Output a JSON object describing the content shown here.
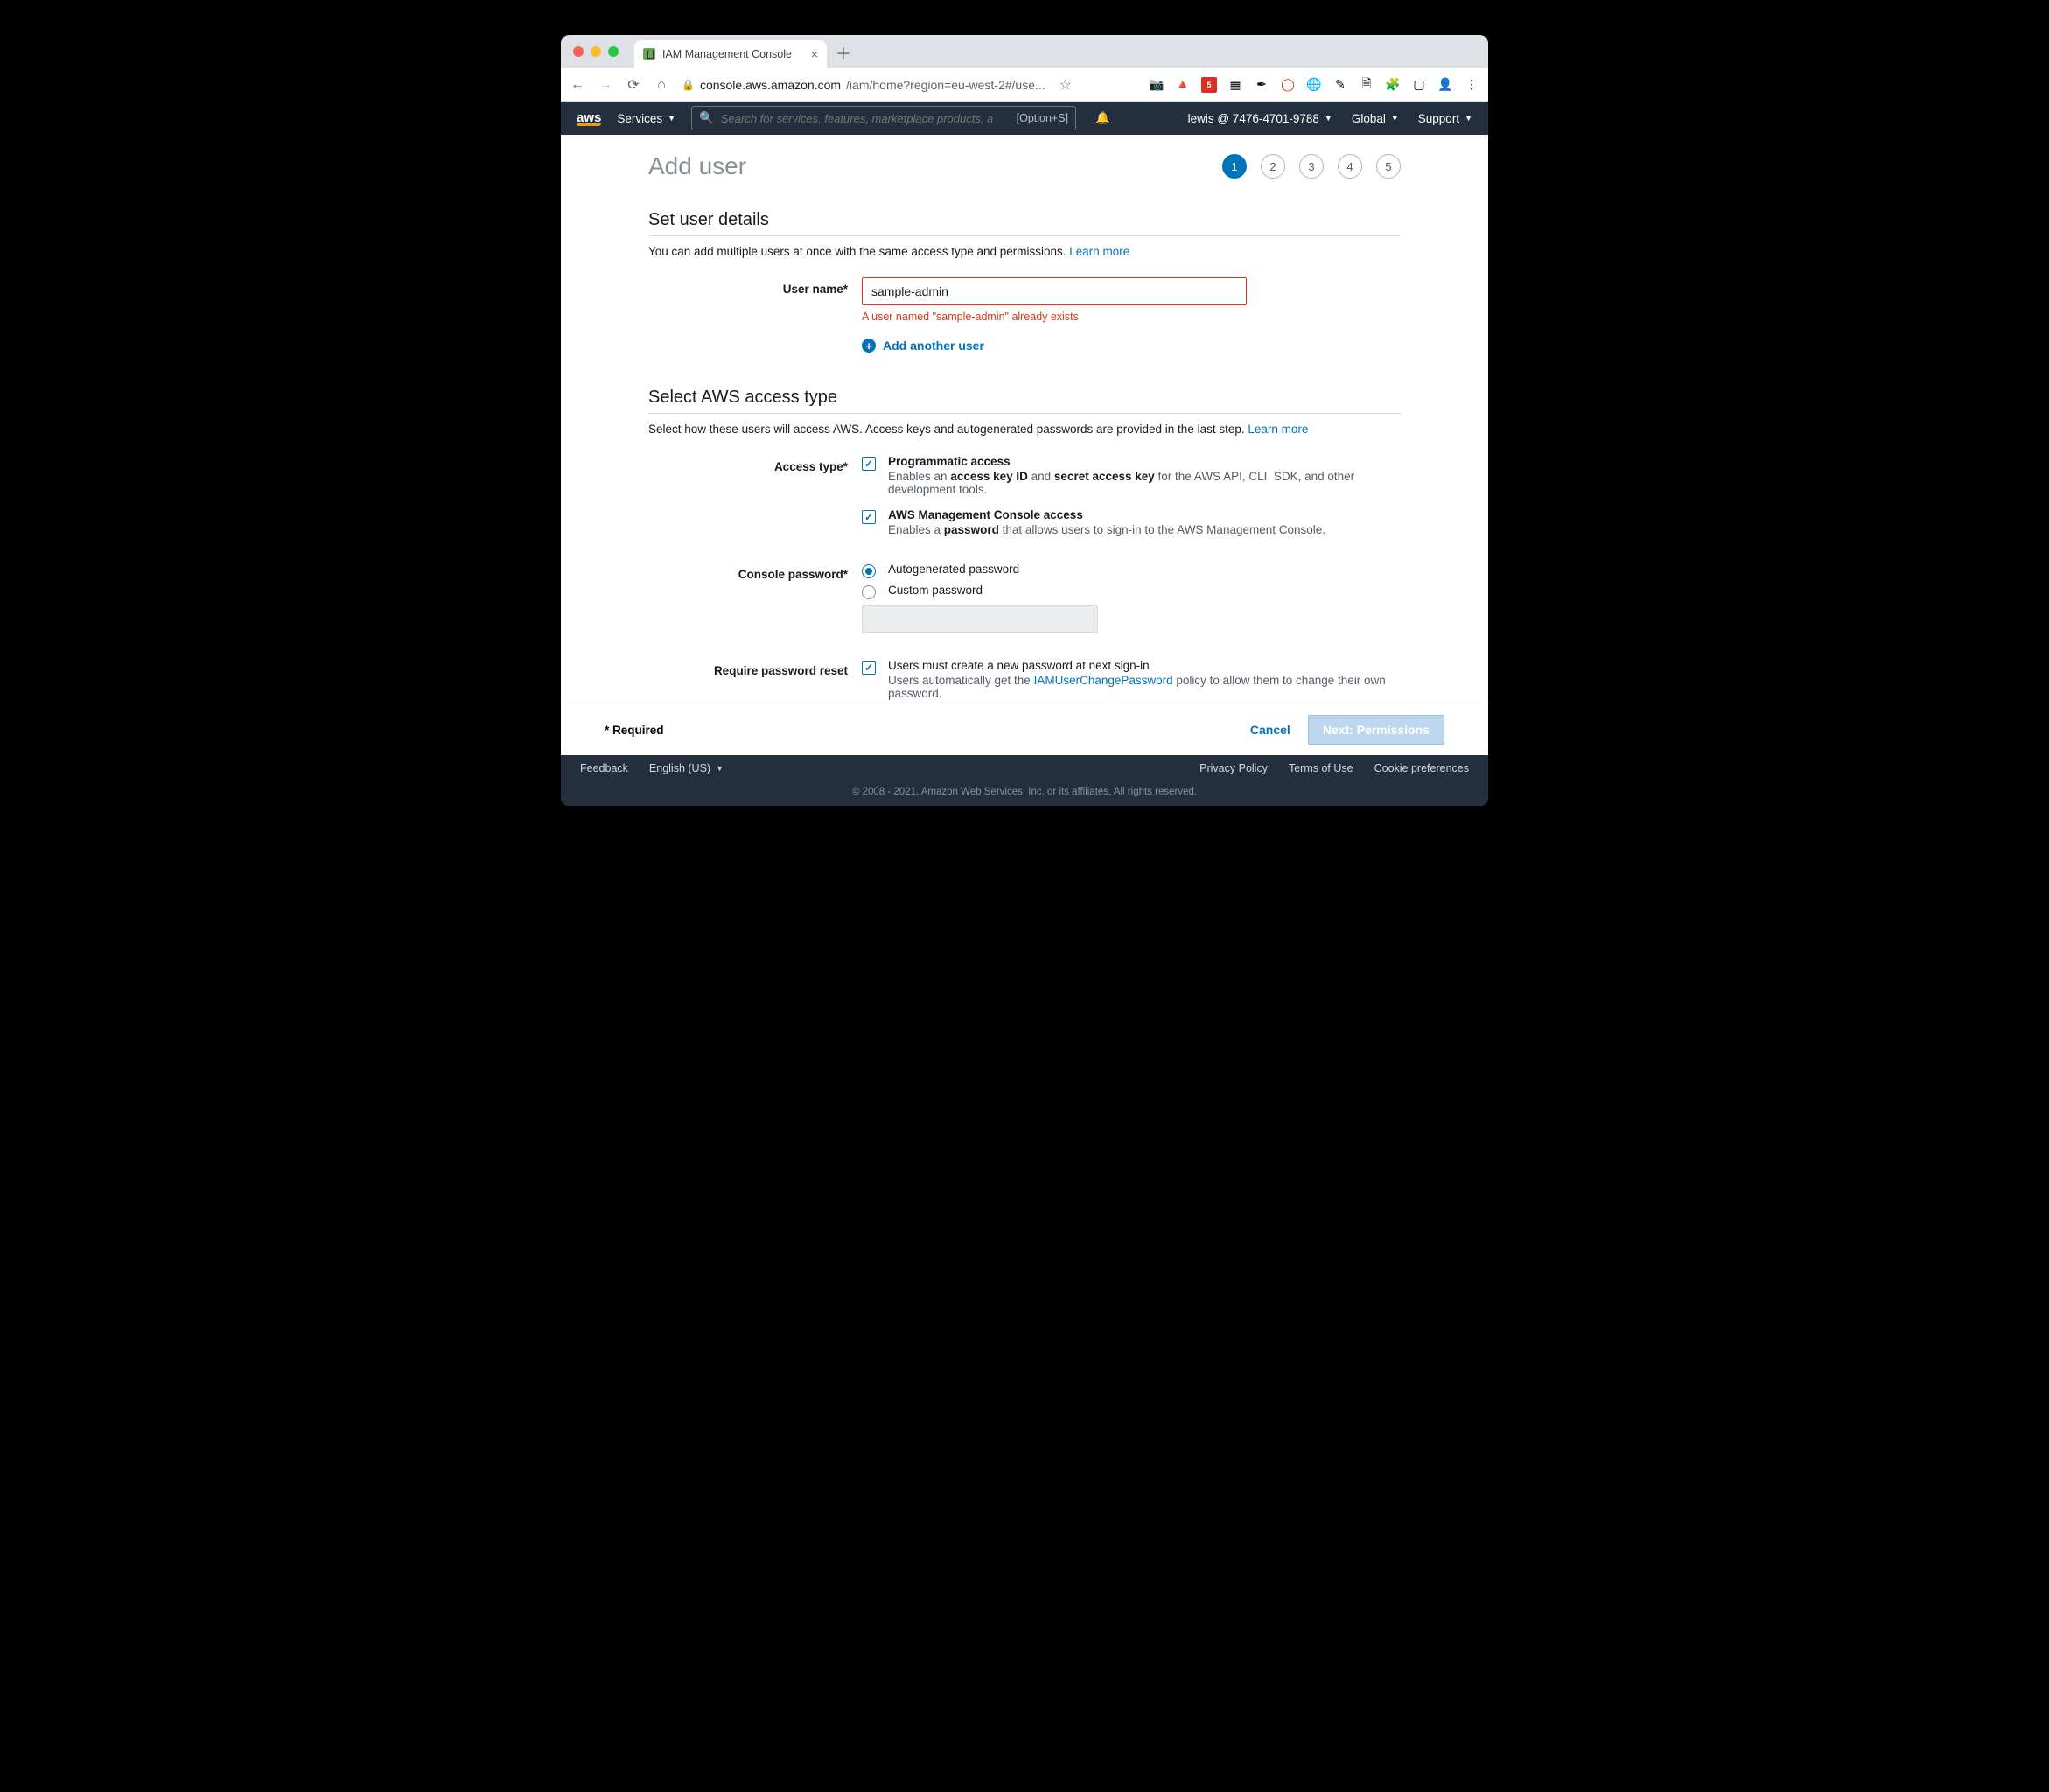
{
  "browser": {
    "tab_title": "IAM Management Console",
    "url_host": "console.aws.amazon.com",
    "url_path": "/iam/home?region=eu-west-2#/use...",
    "star": "☆"
  },
  "aws_nav": {
    "services": "Services",
    "search_placeholder": "Search for services, features, marketplace products, a",
    "search_hint": "[Option+S]",
    "account": "lewis @ 7476-4701-9788",
    "region": "Global",
    "support": "Support"
  },
  "page": {
    "title": "Add user",
    "steps": [
      "1",
      "2",
      "3",
      "4",
      "5"
    ],
    "active_step": 1
  },
  "user_details": {
    "heading": "Set user details",
    "desc": "You can add multiple users at once with the same access type and permissions. ",
    "learn_more": "Learn more",
    "username_label": "User name*",
    "username_value": "sample-admin",
    "username_error": "A user named \"sample-admin\" already exists",
    "add_another": "Add another user"
  },
  "access_type": {
    "heading": "Select AWS access type",
    "desc": "Select how these users will access AWS. Access keys and autogenerated passwords are provided in the last step. ",
    "learn_more": "Learn more",
    "label": "Access type*",
    "programmatic": {
      "title": "Programmatic access",
      "desc_pre": "Enables an ",
      "b1": "access key ID",
      "mid": " and ",
      "b2": "secret access key",
      "desc_post": " for the AWS API, CLI, SDK, and other development tools."
    },
    "console": {
      "title": "AWS Management Console access",
      "desc_pre": "Enables a ",
      "b1": "password",
      "desc_post": " that allows users to sign-in to the AWS Management Console."
    }
  },
  "console_pw": {
    "label": "Console password*",
    "auto": "Autogenerated password",
    "custom": "Custom password"
  },
  "reset": {
    "label": "Require password reset",
    "line1": "Users must create a new password at next sign-in",
    "line2a": "Users automatically get the ",
    "policy": "IAMUserChangePassword",
    "line2b": " policy to allow them to change their own password."
  },
  "actions": {
    "required": "* Required",
    "cancel": "Cancel",
    "next": "Next: Permissions"
  },
  "footer": {
    "feedback": "Feedback",
    "language": "English (US)",
    "privacy": "Privacy Policy",
    "terms": "Terms of Use",
    "cookies": "Cookie preferences",
    "copyright": "© 2008 - 2021, Amazon Web Services, Inc. or its affiliates. All rights reserved."
  }
}
